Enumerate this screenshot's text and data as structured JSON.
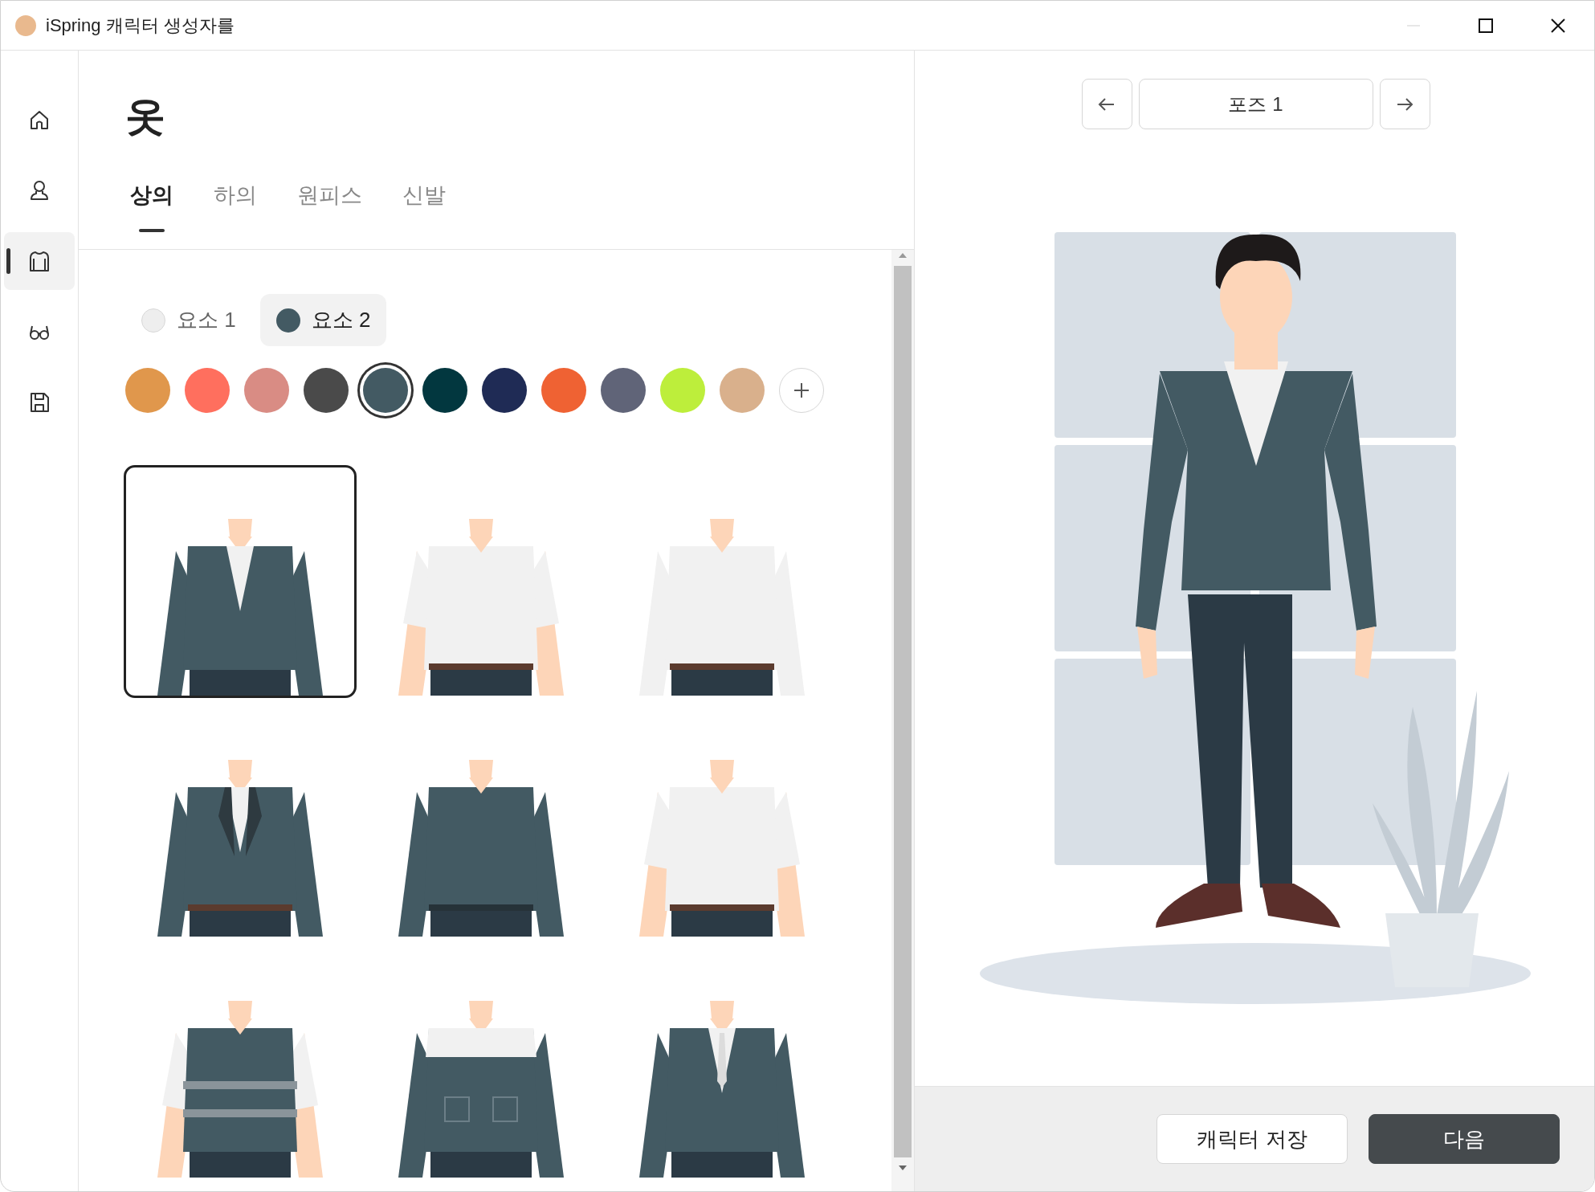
{
  "window": {
    "title": "iSpring 캐릭터 생성자를",
    "controls": [
      {
        "kind": "minimize",
        "disabled": true
      },
      {
        "kind": "maximize",
        "disabled": false
      },
      {
        "kind": "close",
        "disabled": false
      }
    ]
  },
  "sidebar": {
    "items": [
      {
        "kind": "home",
        "selected": false
      },
      {
        "kind": "person",
        "selected": false
      },
      {
        "kind": "shirt",
        "selected": true
      },
      {
        "kind": "glasses",
        "selected": false
      },
      {
        "kind": "save",
        "selected": false
      }
    ]
  },
  "page_title": "옷",
  "tabs": [
    {
      "label": "상의",
      "selected": true
    },
    {
      "label": "하의",
      "selected": false
    },
    {
      "label": "원피스",
      "selected": false
    },
    {
      "label": "신발",
      "selected": false
    }
  ],
  "parts": [
    {
      "label": "요소 1",
      "color": "#eeeeee",
      "selected": false
    },
    {
      "label": "요소 2",
      "color": "#435a63",
      "selected": true
    }
  ],
  "swatches": [
    {
      "color": "#e0974c",
      "selected": false
    },
    {
      "color": "#ff6f5e",
      "selected": false
    },
    {
      "color": "#d98c84",
      "selected": false
    },
    {
      "color": "#4a4a4a",
      "selected": false
    },
    {
      "color": "#435a63",
      "selected": true
    },
    {
      "color": "#02373f",
      "selected": false
    },
    {
      "color": "#1f2b55",
      "selected": false
    },
    {
      "color": "#ef6233",
      "selected": false
    },
    {
      "color": "#606478",
      "selected": false
    },
    {
      "color": "#bdee3b",
      "selected": false
    },
    {
      "color": "#d9b08c",
      "selected": false
    }
  ],
  "outfits": [
    {
      "kind": "cardigan",
      "selected": true
    },
    {
      "kind": "shirt-short",
      "selected": false
    },
    {
      "kind": "shirt-long",
      "selected": false
    },
    {
      "kind": "blazer",
      "selected": false
    },
    {
      "kind": "sweater",
      "selected": false
    },
    {
      "kind": "tshirt",
      "selected": false
    },
    {
      "kind": "vest",
      "selected": false
    },
    {
      "kind": "work-jacket",
      "selected": false
    },
    {
      "kind": "suit",
      "selected": false
    }
  ],
  "preview": {
    "pose": "포즈 1"
  },
  "buttons": [
    {
      "label": "캐릭터 저장",
      "kind": "secondary"
    },
    {
      "label": "다음",
      "kind": "primary"
    }
  ]
}
